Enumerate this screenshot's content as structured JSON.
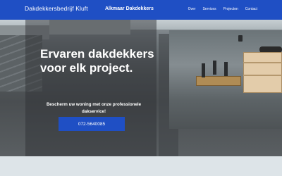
{
  "header": {
    "brand": "Dakdekkersbedrijf Kluft",
    "region": "Alkmaar Dakdekkers",
    "nav": [
      "Over",
      "Services",
      "Projecten",
      "Contact"
    ]
  },
  "hero": {
    "headline_line1": "Ervaren dakdekkers",
    "headline_line2": "voor elk project.",
    "subtext": "Bescherm uw woning met onze professionele dakservice!",
    "cta_label": "072-5640085"
  },
  "colors": {
    "primary": "#1f4fc4",
    "background": "#dde4e8"
  }
}
